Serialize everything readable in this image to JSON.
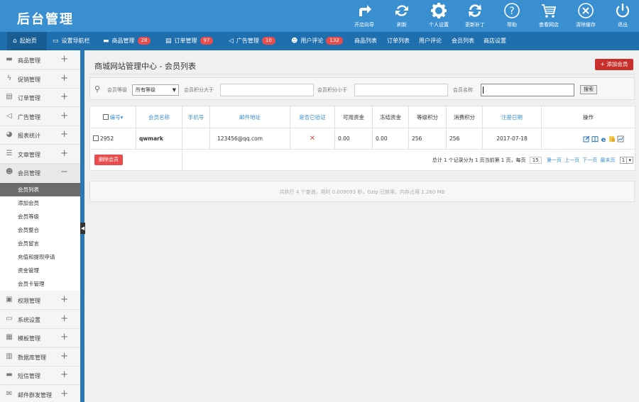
{
  "app": {
    "title": "后台管理"
  },
  "toolbar": [
    {
      "label": "开店向导",
      "icon": "share-arrow-icon"
    },
    {
      "label": "刷新",
      "icon": "refresh-icon"
    },
    {
      "label": "个人设置",
      "icon": "gear-icon"
    },
    {
      "label": "更新补丁",
      "icon": "sync-icon"
    },
    {
      "label": "帮助",
      "icon": "help-icon"
    },
    {
      "label": "查看网店",
      "icon": "cart-icon"
    },
    {
      "label": "清除缓存",
      "icon": "close-circle-icon"
    },
    {
      "label": "退出",
      "icon": "power-icon"
    }
  ],
  "nav": {
    "start": "起始页",
    "setup": "设置导航栏",
    "goods": "商品管理",
    "goods_count": "28",
    "orders": "订单管理",
    "orders_count": "97",
    "ads": "广告管理",
    "ads_count": "10",
    "comments": "用户评论",
    "comments_count": "132",
    "goods_list": "商品列表",
    "order_list": "订单列表",
    "user_comments": "用户评论",
    "member_list": "会员列表",
    "shop_settings": "商店设置"
  },
  "sidebar": {
    "items": [
      {
        "label": "商品管理",
        "icon": "folder-icon"
      },
      {
        "label": "促销管理",
        "icon": "bolt-icon"
      },
      {
        "label": "订单管理",
        "icon": "clipboard-icon"
      },
      {
        "label": "广告管理",
        "icon": "speaker-icon"
      },
      {
        "label": "报表统计",
        "icon": "piechart-icon"
      },
      {
        "label": "文章管理",
        "icon": "list-icon"
      },
      {
        "label": "会员管理",
        "icon": "users-icon"
      }
    ],
    "sub": [
      "会员列表",
      "添加会员",
      "会员等级",
      "会员整合",
      "会员留言",
      "充值和提现申请",
      "资金管理",
      "会员卡管理"
    ],
    "items2": [
      {
        "label": "权限管理",
        "icon": "lock-icon"
      },
      {
        "label": "系统设置",
        "icon": "settings-icon"
      },
      {
        "label": "模板管理",
        "icon": "template-icon"
      },
      {
        "label": "数据库管理",
        "icon": "database-icon"
      },
      {
        "label": "短信管理",
        "icon": "sms-icon"
      },
      {
        "label": "邮件群发管理",
        "icon": "mail-icon"
      }
    ]
  },
  "page": {
    "title": "商城网站管理中心 - 会员列表",
    "add_button": "+ 添加会员"
  },
  "filter": {
    "level_label": "会员等级",
    "level_value": "所有等级",
    "points_gt_label": "会员积分大于",
    "points_lt_label": "会员积分小于",
    "name_label": "会员名称",
    "search_button": "搜索"
  },
  "table": {
    "columns": [
      "编号",
      "会员名称",
      "手机号",
      "邮件地址",
      "是否已验证",
      "可用资金",
      "冻结资金",
      "等级积分",
      "消费积分",
      "注册日期",
      "操作"
    ],
    "rows": [
      {
        "id": "2952",
        "name": "qwmark",
        "phone": "",
        "email": "123456@qq.com",
        "verified": "✕",
        "available": "0.00",
        "frozen": "0.00",
        "level_points": "256",
        "pay_points": "256",
        "reg_date": "2017-07-18"
      }
    ],
    "delete_button": "删除会员",
    "pagination": {
      "summary": "总计 1 个记录分为 1 页当前第 1 页，每页",
      "per_page": "15",
      "links": [
        "第一页",
        "上一页",
        "下一页",
        "最末页"
      ],
      "page_select": "1"
    }
  },
  "footer": {
    "text": "共执行 4 个查询，用时 0.009093 秒，Gzip 已禁用，内存占用 1.260 MB"
  }
}
